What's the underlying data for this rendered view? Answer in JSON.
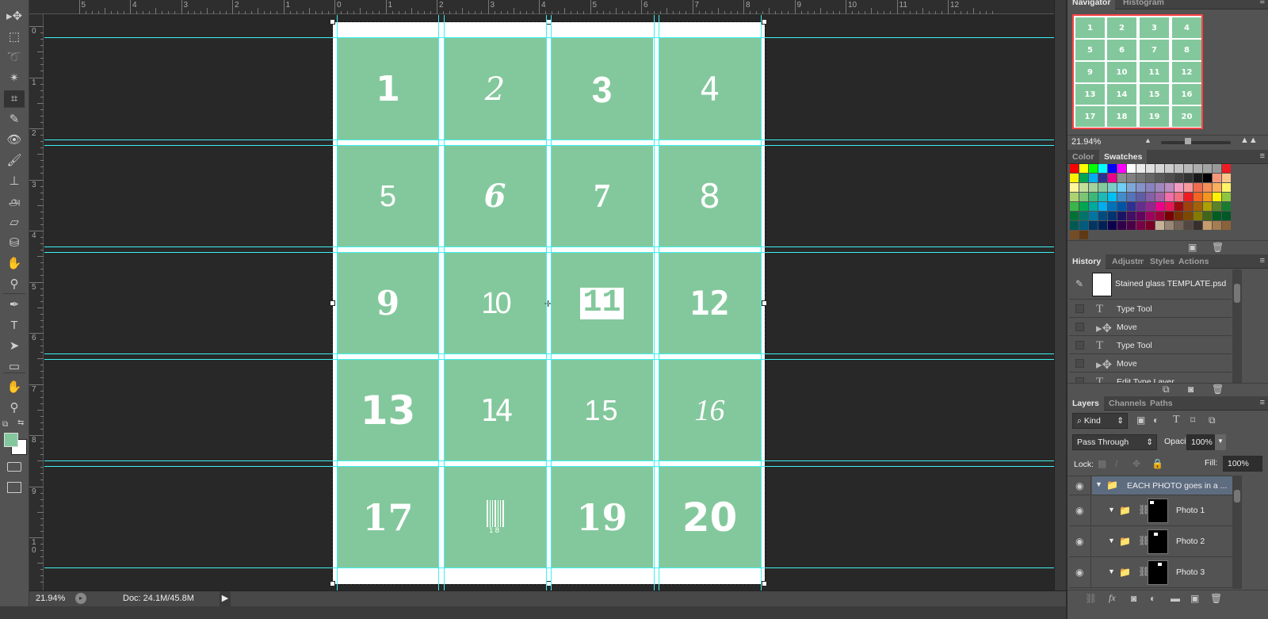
{
  "tools": [
    {
      "name": "move-tool",
      "glyph": "▸✥"
    },
    {
      "name": "marquee-tool",
      "glyph": "⬚"
    },
    {
      "name": "lasso-tool",
      "glyph": "➰"
    },
    {
      "name": "magic-wand-tool",
      "glyph": "✴"
    },
    {
      "name": "crop-tool",
      "glyph": "⌗",
      "active": true
    },
    {
      "name": "eyedropper-tool",
      "glyph": "✎"
    },
    {
      "name": "spot-healing-tool",
      "glyph": "👁"
    },
    {
      "name": "brush-tool",
      "glyph": "🖌"
    },
    {
      "name": "clone-stamp-tool",
      "glyph": "⊥"
    },
    {
      "name": "history-brush-tool",
      "glyph": "௮"
    },
    {
      "name": "eraser-tool",
      "glyph": "▱"
    },
    {
      "name": "paint-bucket-tool",
      "glyph": "⛁"
    },
    {
      "name": "blur-tool",
      "glyph": "✋"
    },
    {
      "name": "dodge-tool",
      "glyph": "⚲"
    },
    {
      "name": "pen-tool",
      "glyph": "✒"
    },
    {
      "name": "type-tool",
      "glyph": "T"
    },
    {
      "name": "path-selection-tool",
      "glyph": "➤"
    },
    {
      "name": "rectangle-tool",
      "glyph": "▭"
    },
    {
      "name": "hand-tool",
      "glyph": "✋"
    },
    {
      "name": "zoom-tool",
      "glyph": "⚲"
    }
  ],
  "colors": {
    "foreground": "#83c89c",
    "background": "#ffffff",
    "cell": "#83c89c",
    "guide": "#3ff0f0",
    "navigator_frame": "#ff4444"
  },
  "rulers": {
    "top": [
      "5",
      "4",
      "3",
      "2",
      "1",
      "0",
      "1",
      "2",
      "3",
      "4",
      "5",
      "6",
      "7",
      "8",
      "9",
      "10",
      "11",
      "12"
    ],
    "left": [
      "0",
      "1",
      "2",
      "3",
      "4",
      "5",
      "6",
      "7",
      "8",
      "9",
      "1 0"
    ]
  },
  "document": {
    "cells": [
      "1",
      "2",
      "3",
      "4",
      "5",
      "6",
      "7",
      "8",
      "9",
      "10",
      "11",
      "12",
      "13",
      "14",
      "15",
      "16",
      "17",
      "18",
      "19",
      "20"
    ]
  },
  "status": {
    "zoom": "21.94%",
    "doc": "Doc: 24.1M/45.8M"
  },
  "navigator": {
    "tabs": [
      "Navigator",
      "Histogram"
    ],
    "active": 0,
    "zoom": "21.94%"
  },
  "swatches": {
    "tabs": [
      "Color",
      "Swatches"
    ],
    "active": 1,
    "colors": [
      "#ff0000",
      "#ffff00",
      "#00ff00",
      "#00ffff",
      "#0000ff",
      "#ff00ff",
      "#ffffff",
      "#ebebeb",
      "#e0e0e0",
      "#d6d6d6",
      "#cccccc",
      "#c2c2c2",
      "#b8b8b8",
      "#adadad",
      "#a3a3a3",
      "#999999",
      "#ed1c24",
      "#fff200",
      "#00a651",
      "#00aeef",
      "#2e3192",
      "#ec008c",
      "#8c8c8c",
      "#808080",
      "#737373",
      "#666666",
      "#595959",
      "#4d4d4d",
      "#404040",
      "#333333",
      "#1a1a1a",
      "#000000",
      "#f7977a",
      "#fdc68a",
      "#fff79a",
      "#c4df9b",
      "#a3d39c",
      "#82ca9d",
      "#7bcdc8",
      "#6ecff6",
      "#7ea7d8",
      "#8493ca",
      "#8882be",
      "#a187be",
      "#bc8dbf",
      "#f49ac2",
      "#f6989d",
      "#f26c4f",
      "#f68e55",
      "#fbaf5c",
      "#fff467",
      "#acd372",
      "#7cc576",
      "#3bb878",
      "#1abbb4",
      "#00bff3",
      "#438ccb",
      "#5574b9",
      "#605ca8",
      "#855fa8",
      "#a763a8",
      "#f06ea9",
      "#f26d7d",
      "#ed1c24",
      "#f26522",
      "#f7941d",
      "#fff200",
      "#8dc63f",
      "#39b54a",
      "#00a651",
      "#00a99d",
      "#00aeef",
      "#0072bc",
      "#0054a6",
      "#2e3192",
      "#662d91",
      "#92278f",
      "#ec008c",
      "#ed145b",
      "#9e0b0f",
      "#a0410d",
      "#a36209",
      "#aba000",
      "#598527",
      "#197b30",
      "#007236",
      "#00746b",
      "#0076a3",
      "#004b80",
      "#003471",
      "#1b1464",
      "#440e62",
      "#630460",
      "#9e005d",
      "#9e0039",
      "#790000",
      "#7b2e00",
      "#7d4900",
      "#827b00",
      "#406618",
      "#005e20",
      "#005826",
      "#005952",
      "#005b7f",
      "#003663",
      "#002157",
      "#0d004c",
      "#32004b",
      "#4b0049",
      "#7b0046",
      "#7a0026",
      "#c7b299",
      "#998675",
      "#736357",
      "#534741",
      "#362f2d",
      "#c69c6d",
      "#a67c52",
      "#8c6239",
      "#754c24",
      "#603913"
    ]
  },
  "history": {
    "tabs": [
      "History",
      "Adjustme",
      "Styles",
      "Actions"
    ],
    "active": 0,
    "snapshot": "Stained glass TEMPLATE.psd",
    "items": [
      {
        "label": "Type Tool",
        "icon": "type-icon"
      },
      {
        "label": "Move",
        "icon": "move-icon"
      },
      {
        "label": "Type Tool",
        "icon": "type-icon"
      },
      {
        "label": "Move",
        "icon": "move-icon"
      },
      {
        "label": "Edit Type Layer",
        "icon": "type-icon"
      }
    ]
  },
  "layers": {
    "tabs": [
      "Layers",
      "Channels",
      "Paths"
    ],
    "active": 0,
    "filter": "Kind",
    "blend_mode": "Pass Through",
    "opacity_label": "Opacity:",
    "opacity": "100%",
    "lock_label": "Lock:",
    "fill_label": "Fill:",
    "fill": "100%",
    "items": [
      {
        "name": "EACH PHOTO goes in a ...",
        "type": "group",
        "selected": true
      },
      {
        "name": "Photo 1",
        "type": "group"
      },
      {
        "name": "Photo 2",
        "type": "group"
      },
      {
        "name": "Photo 3",
        "type": "group"
      }
    ]
  }
}
